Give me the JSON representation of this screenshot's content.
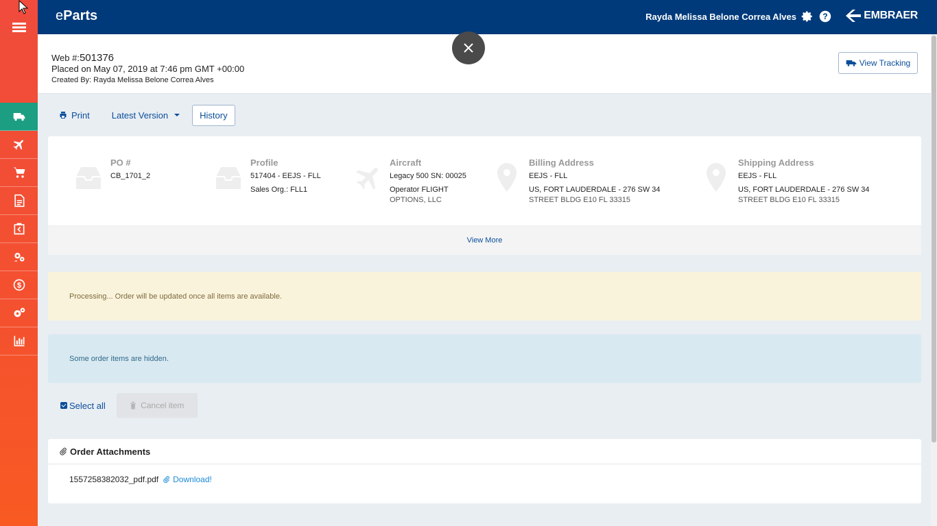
{
  "app": {
    "logo_prefix": "e",
    "logo_suffix": "Parts",
    "brand": "EMBRAER"
  },
  "header": {
    "user_name": "Rayda Melissa Belone Correa Alves"
  },
  "sidebar": {
    "items": [
      {
        "name": "orders",
        "icon": "truck-icon",
        "active": true
      },
      {
        "name": "flights",
        "icon": "plane-icon"
      },
      {
        "name": "cart",
        "icon": "cart-icon"
      },
      {
        "name": "documents",
        "icon": "document-icon"
      },
      {
        "name": "returns",
        "icon": "return-box-icon"
      },
      {
        "name": "exchange",
        "icon": "exchange-gears-icon"
      },
      {
        "name": "finance",
        "icon": "dollar-icon"
      },
      {
        "name": "settings",
        "icon": "gears-icon"
      },
      {
        "name": "reports",
        "icon": "bar-chart-icon"
      }
    ]
  },
  "order": {
    "web_label": "Web #:",
    "web_number": "501376",
    "placed": "Placed on May 07, 2019 at 7:46 pm GMT +00:00",
    "created_by": "Created By: Rayda Melissa Belone Correa Alves",
    "view_tracking": "View Tracking"
  },
  "toolbar": {
    "print": "Print",
    "latest_version": "Latest Version",
    "history": "History"
  },
  "info": {
    "po": {
      "title": "PO #",
      "line1": "CB_1701_2"
    },
    "profile": {
      "title": "Profile",
      "line1": "517404 - EEJS - FLL",
      "line2": "Sales Org.: FLL1"
    },
    "aircraft": {
      "title": "Aircraft",
      "line1": "Legacy 500 SN: 00025",
      "line2": "Operator FLIGHT",
      "line3": "OPTIONS, LLC"
    },
    "billing": {
      "title": "Billing Address",
      "line1": "EEJS - FLL",
      "line2": "US, FORT LAUDERDALE - 276 SW 34",
      "line3": "STREET BLDG E10 FL 33315"
    },
    "shipping": {
      "title": "Shipping Address",
      "line1": "EEJS - FLL",
      "line2": "US, FORT LAUDERDALE - 276 SW 34",
      "line3": "STREET BLDG E10 FL 33315"
    },
    "view_more": "View More"
  },
  "alerts": {
    "processing": "Processing... Order will be updated once all items are available.",
    "hidden": "Some order items are hidden."
  },
  "actions": {
    "select_all": "Select all",
    "cancel_item": "Cancel item"
  },
  "attachments": {
    "title": "Order Attachments",
    "files": [
      {
        "name": "1557258382032_pdf.pdf",
        "download": "Download!"
      }
    ]
  },
  "colors": {
    "sidebar_top": "#f04b3c",
    "sidebar_bottom": "#f85a22",
    "sidebar_active": "#1b9e82",
    "header": "#003a7a",
    "link": "#0a4d9a",
    "warning_bg": "#faf3dc",
    "info_bg": "#d9e9f1"
  }
}
